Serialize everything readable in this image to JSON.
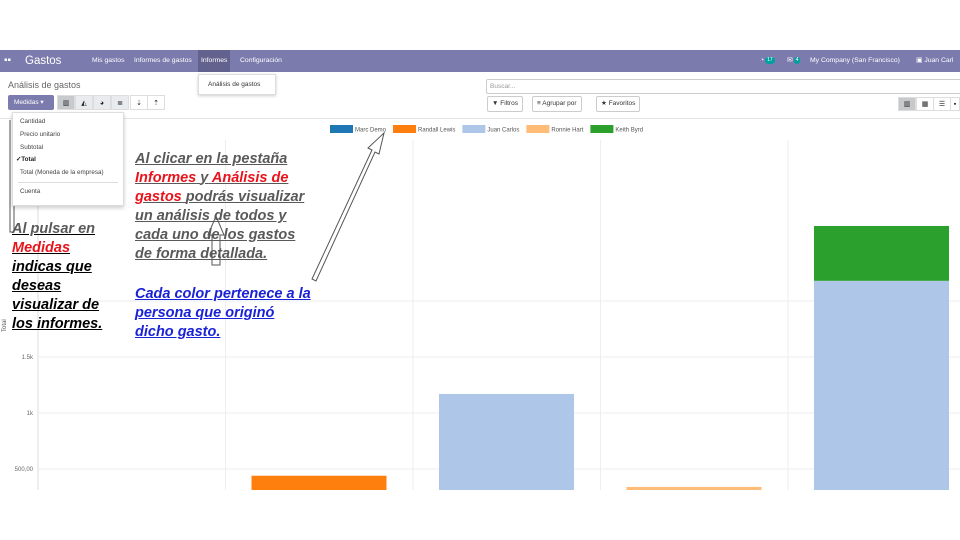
{
  "navbar": {
    "app_title": "Gastos",
    "apps_icon": "grid-icon",
    "menus": [
      "Mis gastos",
      "Informes de gastos",
      "Informes",
      "Configuración"
    ],
    "activity_count": "17",
    "messages_count": "4",
    "company": "My Company (San Francisco)",
    "user": "Juan Carl"
  },
  "breadcrumb": "Análisis de gastos",
  "informes_dropdown": {
    "item": "Análisis de gastos"
  },
  "controls": {
    "measures_label": "Medidas ▾",
    "search_placeholder": "Buscar...",
    "filters_label": "Filtros",
    "groupby_label": "Agrupar por",
    "favorites_label": "Favoritos"
  },
  "measures_menu": {
    "items": [
      "Cantidad",
      "Precio unitario",
      "Subtotal",
      "Total",
      "Total (Moneda de la empresa)",
      "Cuenta"
    ],
    "selected": "Total"
  },
  "annotations": {
    "measures_note": [
      "Al pulsar en",
      "Medidas",
      "indicas que",
      "deseas",
      "visualizar de",
      "los informes."
    ],
    "analysis_note": [
      "Al clicar  en la pestaña",
      "Informes",
      "y",
      "Análisis de",
      "gastos",
      "podrás visualizar",
      "un análisis de todos y",
      "cada uno de los gastos",
      "de forma detallada."
    ],
    "color_note": [
      "Cada color pertenece a la",
      "persona que originó",
      "dicho gasto."
    ]
  },
  "colors": {
    "navbar": "#7c7bad",
    "annotation_gray": "#595959",
    "annotation_red": "#e8141b",
    "annotation_blue": "#1a22d6"
  },
  "chart_data": {
    "type": "bar",
    "stacked": true,
    "ylabel": "Total",
    "ytick_labels": [
      "500,00",
      "1k",
      "1.5k"
    ],
    "ylim_visible": [
      300,
      2400
    ],
    "legend": "top-center",
    "categories_visible_count": 5,
    "series": [
      {
        "name": "Marc Demo",
        "color": "#1f77b4",
        "values": [
          0,
          0,
          0,
          0,
          0
        ]
      },
      {
        "name": "Randall Lewis",
        "color": "#ff7f0e",
        "values": [
          0,
          440,
          0,
          0,
          0
        ]
      },
      {
        "name": "Juan Carlos",
        "color": "#aec7e8",
        "values": [
          0,
          0,
          1170,
          0,
          2180
        ]
      },
      {
        "name": "Ronnie Hart",
        "color": "#ffbb78",
        "values": [
          0,
          0,
          0,
          340,
          0
        ]
      },
      {
        "name": "Keith Byrd",
        "color": "#2ca02c",
        "values": [
          0,
          0,
          0,
          0,
          490
        ]
      }
    ]
  }
}
